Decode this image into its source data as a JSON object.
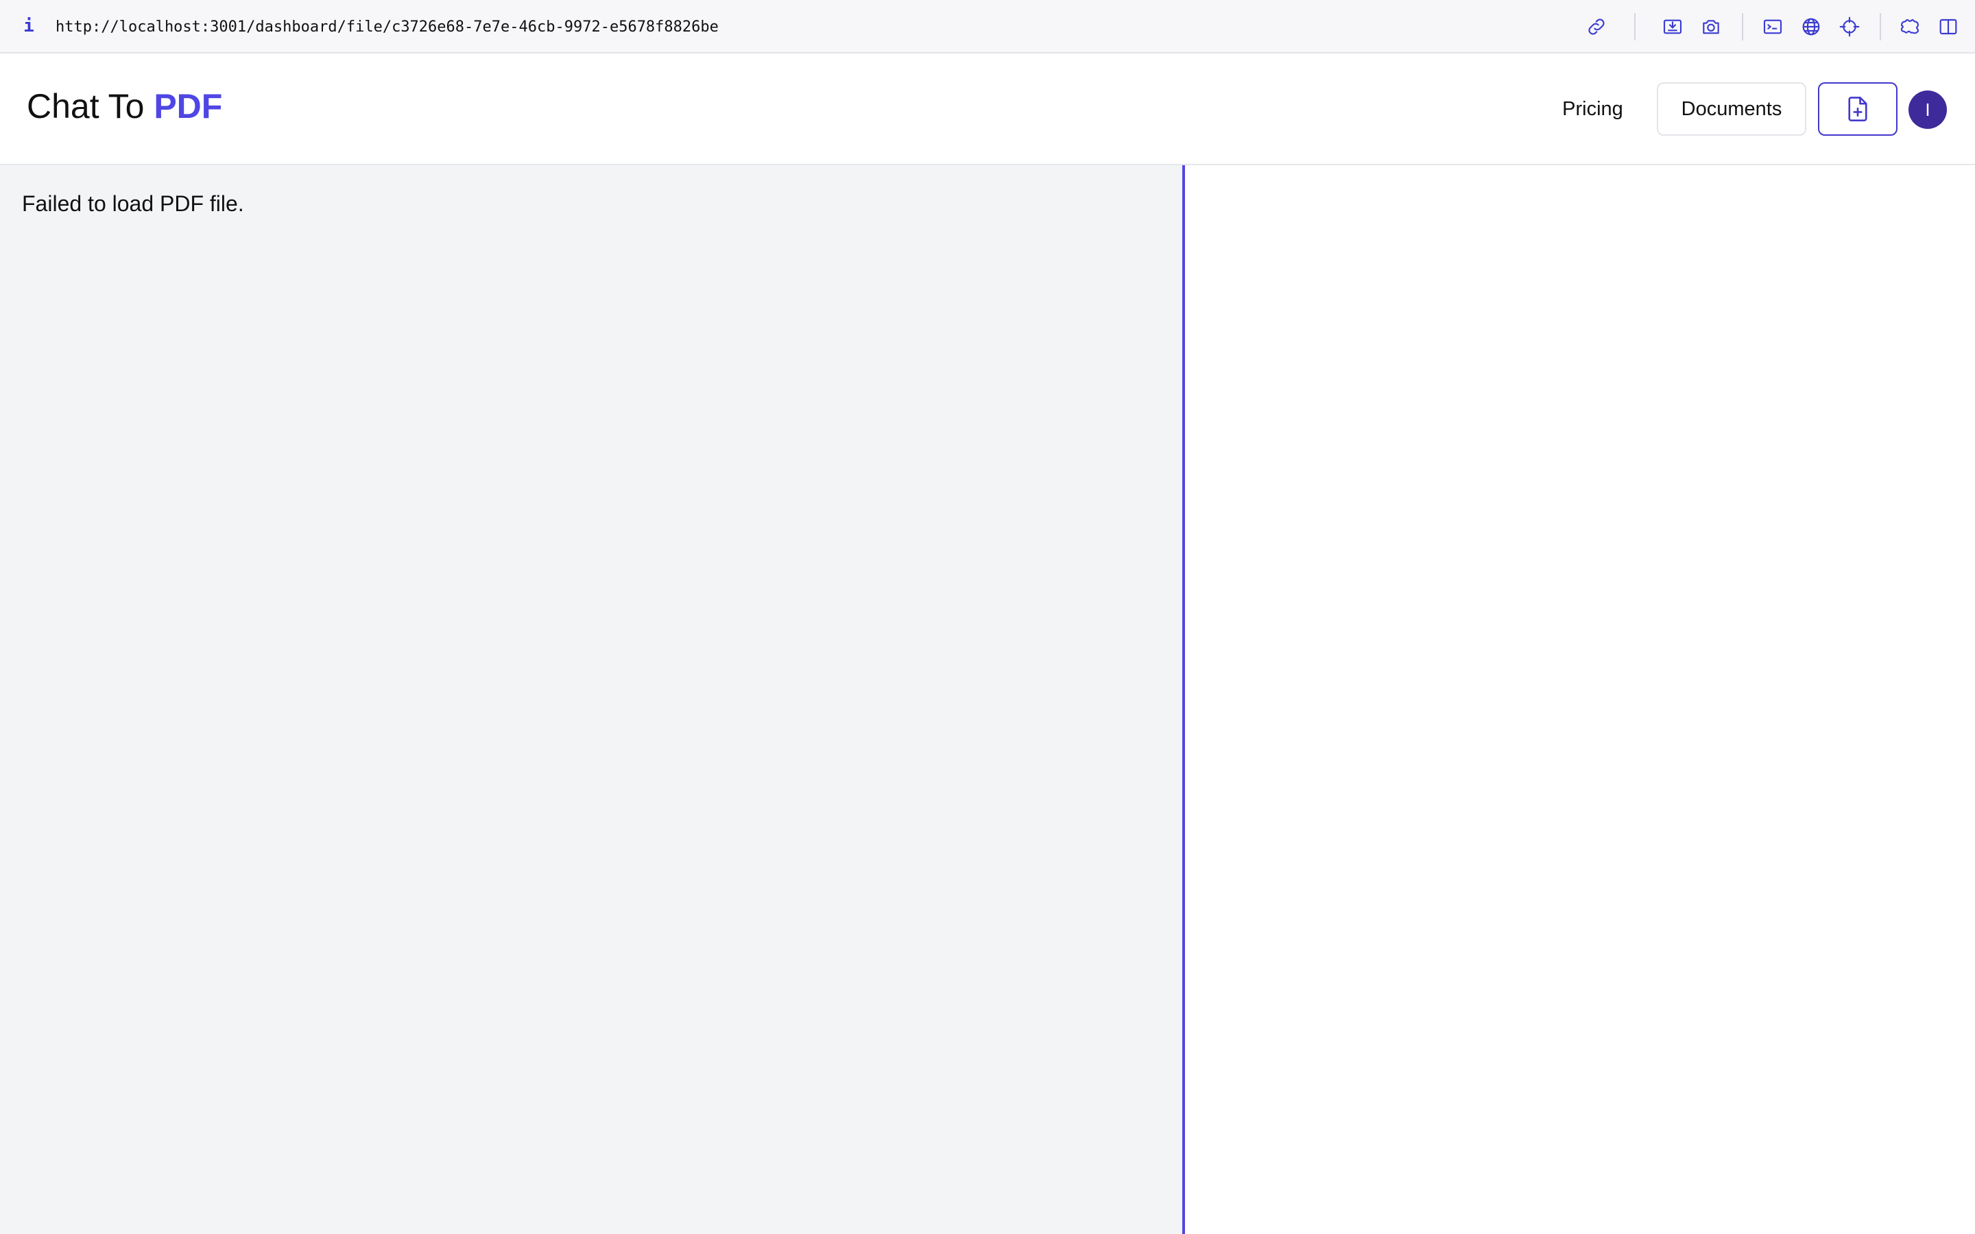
{
  "browser": {
    "info_icon_glyph": "i",
    "url": "http://localhost:3001/dashboard/file/c3726e68-7e7e-46cb-9972-e5678f8826be",
    "toolbar_icons": [
      "link-icon",
      "inspect-icon",
      "camera-icon",
      "terminal-icon",
      "globe-icon",
      "crosshair-icon",
      "extension-icon",
      "sidebar-toggle-icon"
    ]
  },
  "header": {
    "logo_prefix": "Chat To ",
    "logo_accent": "PDF",
    "nav_pricing": "Pricing",
    "nav_documents": "Documents",
    "upload_icon": "file-plus-icon",
    "avatar_initial": "I"
  },
  "pdf_viewer": {
    "error_message": "Failed to load PDF file."
  },
  "colors": {
    "accent": "#4f46e5",
    "avatar": "#3f2a9c",
    "pdf_pane_bg": "#f3f4f6",
    "browser_icon": "#3b3bd1"
  }
}
